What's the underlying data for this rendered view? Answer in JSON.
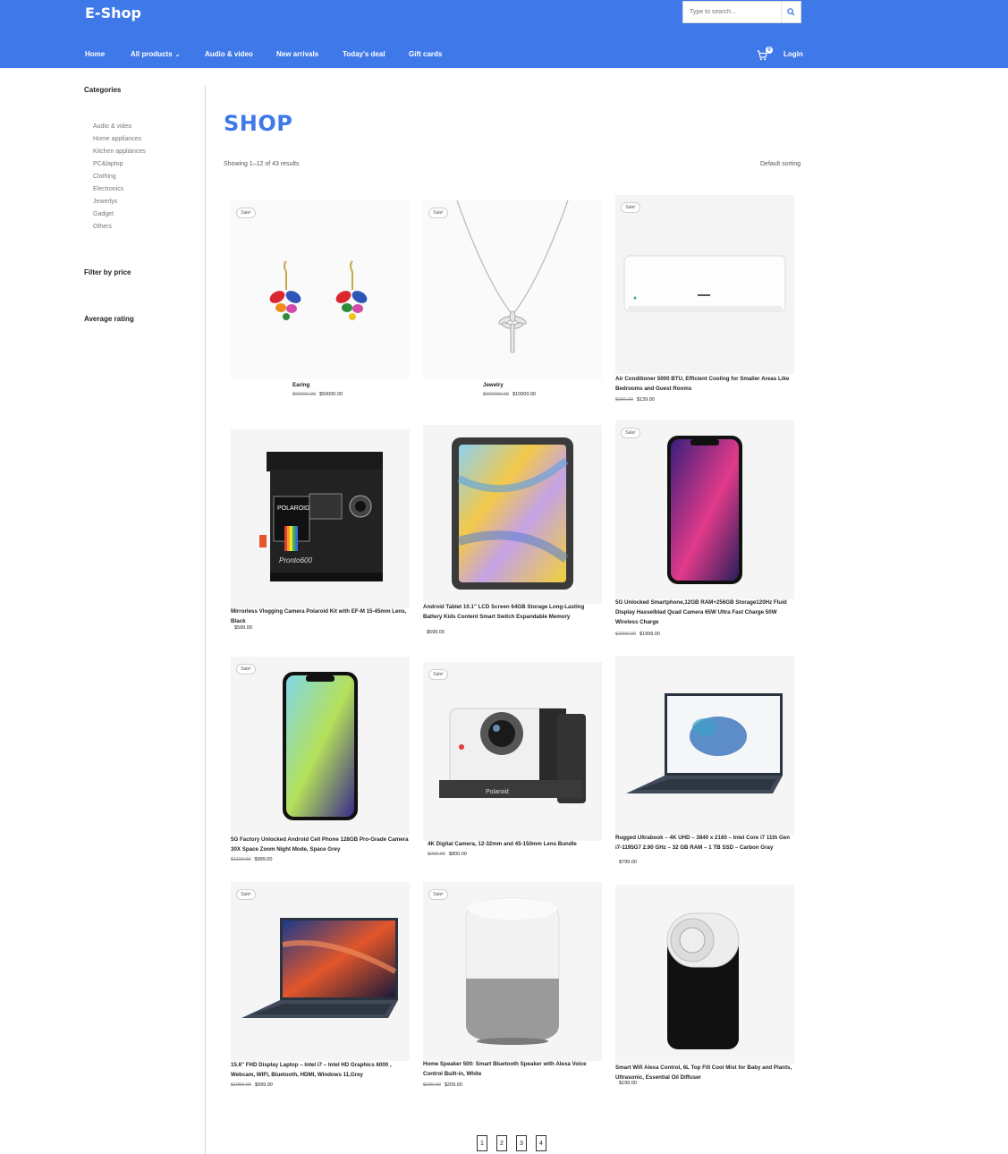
{
  "header": {
    "brand": "E-Shop",
    "search_placeholder": "Type to search...",
    "nav": [
      "Home",
      "All products",
      "Audio & video",
      "New arrivals",
      "Today's deal",
      "Gift cards"
    ],
    "cart_count": "0",
    "login": "Login"
  },
  "sidebar": {
    "categories_title": "Categories",
    "categories": [
      "Audio & video",
      "Home appliances",
      "Kitchen appliances",
      "PC&laptop",
      "Clothing",
      "Electronics",
      "Jewerlys",
      "Gadget",
      "Others"
    ],
    "filter_price_title": "Filter by price",
    "avg_rating_title": "Average rating"
  },
  "main": {
    "title": "SHOP",
    "result_count": "Showing 1–12 of 43 results",
    "sorting": "Default sorting",
    "sale_label": "Sale!",
    "products": [
      {
        "name": "Earing",
        "old_price": "$60000.00",
        "price": "$50000.00",
        "sale": true,
        "image": "earring-image"
      },
      {
        "name": "Jewelry",
        "old_price": "$600000.00",
        "price": "$10000.00",
        "sale": true,
        "image": "necklace-image"
      },
      {
        "name": "Air Conditioner 5000 BTU, Efficient Cooling for Smaller Areas Like Bedrooms and Guest Rooms",
        "old_price": "$150.00",
        "price": "$139.00",
        "sale": true,
        "image": "air-conditioner-image"
      },
      {
        "name": "Mirrorless Vlogging Camera Polaroid Kit with EF-M 15-45mm Lens, Black",
        "old_price": "",
        "price": "$599.00",
        "sale": false,
        "image": "polaroid-camera-image"
      },
      {
        "name": "Android Tablet 10.1\" LCD Screen 64GB Storage Long-Lasting Battery Kids Content Smart Switch Expandable Memory",
        "old_price": "",
        "price": "$599.00",
        "sale": false,
        "image": "tablet-image"
      },
      {
        "name": "5G Unlocked Smartphone,12GB RAM+256GB Storage120Hz Fluid Display Hasselblad Quad Camera 65W Ultra Fast Charge 50W Wireless Charge",
        "old_price": "$2000.00",
        "price": "$1999.00",
        "sale": true,
        "image": "smartphone-image"
      },
      {
        "name": "5G Factory Unlocked Android Cell Phone 128GB Pro-Grade Camera 30X Space Zoom Night Mode, Space Grey",
        "old_price": "$1100.00",
        "price": "$999.00",
        "sale": true,
        "image": "cell-phone-image"
      },
      {
        "name": "4K Digital Camera, 12-32mm and 45-150mm Lens Bundle",
        "old_price": "$900.00",
        "price": "$800.00",
        "sale": true,
        "image": "instant-camera-image"
      },
      {
        "name": "Rugged Ultrabook – 4K UHD – 3840 x 2160 – Intel Core i7 11th Gen i7-1195G7 2.90 GHz – 32 GB RAM – 1 TB SSD – Carbon Gray",
        "old_price": "",
        "price": "$799.00",
        "sale": false,
        "image": "ultrabook-image"
      },
      {
        "name": "15.6\" FHD Display Laptop – Intel i7 – Intel HD Graphics 6000 , Webcam, WIFI, Bluetooth, HDMI, Windows 11,Grey",
        "old_price": "$1050.00",
        "price": "$999.00",
        "sale": true,
        "image": "laptop-image"
      },
      {
        "name": "Home Speaker 500: Smart Bluetooth Speaker with Alexa Voice Control Built-in, White",
        "old_price": "$220.00",
        "price": "$209.00",
        "sale": true,
        "image": "smart-speaker-image"
      },
      {
        "name": "Smart Wifi Alexa Control, 6L Top Fill Cool Mist for Baby and Plants, Ultrasonic, Essential Oil Diffuser",
        "old_price": "",
        "price": "$199.00",
        "sale": false,
        "image": "diffuser-image"
      }
    ]
  },
  "pagination": [
    "1",
    "2",
    "3",
    "4"
  ],
  "colors": {
    "accent": "#3f78e8"
  }
}
